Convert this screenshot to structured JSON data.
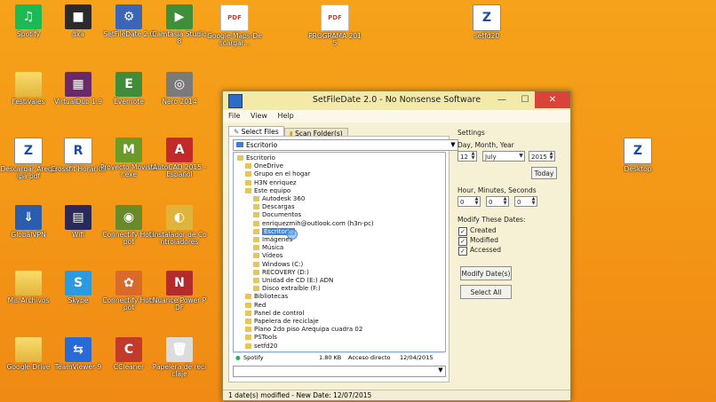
{
  "desktop": {
    "icons": [
      {
        "label": "Spotify",
        "glyph": "♫",
        "color": "#1db954"
      },
      {
        "label": "dxa",
        "glyph": "■",
        "color": "#2b2b2b"
      },
      {
        "label": "SetFileDate 2.0",
        "glyph": "⚙",
        "color": "#3b66b5"
      },
      {
        "label": "Camtasia Studio 8",
        "glyph": "▶",
        "color": "#3e8e3a"
      },
      {
        "label": "Google Maps-Descargar...",
        "glyph": "PDF",
        "color": "#d63c2c"
      },
      {
        "label": "PROGRAMA 2015",
        "glyph": "PDF",
        "color": "#d63c2c"
      },
      {
        "label": "setfd20",
        "glyph": "Z",
        "color": "#ffffff"
      },
      {
        "label": "Festivales",
        "glyph": "▮",
        "color": "#e6b23b"
      },
      {
        "label": "VirtualDub 1.9",
        "glyph": "▦",
        "color": "#6a2a6a"
      },
      {
        "label": "Evernote",
        "glyph": "E",
        "color": "#3f8c3a"
      },
      {
        "label": "Nero 2014",
        "glyph": "◎",
        "color": "#7a7a7a"
      },
      {
        "label": "Descargar Arequipa pdf",
        "glyph": "Z",
        "color": "#ffffff"
      },
      {
        "label": "Crossfit Horarios",
        "glyph": "R",
        "color": "#ffffff"
      },
      {
        "label": "Proyecto Movistar.exe",
        "glyph": "M",
        "color": "#6a9a2a"
      },
      {
        "label": "AutoCAD 2015 - Español",
        "glyph": "A",
        "color": "#c22a2a"
      },
      {
        "label": "Desktop",
        "glyph": "Z",
        "color": "#ffffff"
      },
      {
        "label": "GlobalVPN",
        "glyph": "⇓",
        "color": "#2a5db0"
      },
      {
        "label": "Wifi",
        "glyph": "▤",
        "color": "#2a2a5a"
      },
      {
        "label": "Connectify Hotspot",
        "glyph": "◉",
        "color": "#6a8a2a"
      },
      {
        "label": "Instalador de Controladores",
        "glyph": "◐",
        "color": "#e0b43a"
      },
      {
        "label": "Mis Archivos",
        "glyph": "▮",
        "color": "#e6b23b"
      },
      {
        "label": "Skype",
        "glyph": "S",
        "color": "#2a9be0"
      },
      {
        "label": "Connectify Hotspot",
        "glyph": "✿",
        "color": "#d96a2a"
      },
      {
        "label": "Nuance Power PDF",
        "glyph": "N",
        "color": "#b52a2a"
      },
      {
        "label": "Google Drive",
        "glyph": "▮",
        "color": "#e6b23b"
      },
      {
        "label": "TeamViewer 9",
        "glyph": "⇆",
        "color": "#2a6ad6"
      },
      {
        "label": "CCleaner",
        "glyph": "C",
        "color": "#c23a2a"
      },
      {
        "label": "Papelera de reciclaje",
        "glyph": "🗑",
        "color": "#dcdcdc"
      }
    ]
  },
  "window": {
    "title": "SetFileDate 2.0 - No Nonsense Software",
    "menu": [
      "File",
      "View",
      "Help"
    ],
    "controls": {
      "minimize": "—",
      "maximize": "☐",
      "close": "✕"
    },
    "tabs": [
      "Select Files",
      "Scan Folder(s)"
    ],
    "combo_value": "Escritorio",
    "tree": [
      {
        "label": "Escritorio",
        "indent": 0
      },
      {
        "label": "OneDrive",
        "indent": 1
      },
      {
        "label": "Grupo en el hogar",
        "indent": 1
      },
      {
        "label": "H3N enriquez",
        "indent": 1
      },
      {
        "label": "Este equipo",
        "indent": 1
      },
      {
        "label": "Autodesk 360",
        "indent": 2
      },
      {
        "label": "Descargas",
        "indent": 2
      },
      {
        "label": "Documentos",
        "indent": 2
      },
      {
        "label": "enriquezmih@outlook.com (h3n-pc)",
        "indent": 2
      },
      {
        "label": "Escritorio",
        "indent": 2,
        "selected": true
      },
      {
        "label": "Imágenes",
        "indent": 2
      },
      {
        "label": "Música",
        "indent": 2
      },
      {
        "label": "Vídeos",
        "indent": 2
      },
      {
        "label": "Windows (C:)",
        "indent": 2
      },
      {
        "label": "RECOVERY (D:)",
        "indent": 2
      },
      {
        "label": "Unidad de CD (E:) ADN",
        "indent": 2
      },
      {
        "label": "Disco extraíble (F:)",
        "indent": 2
      },
      {
        "label": "Bibliotecas",
        "indent": 1
      },
      {
        "label": "Red",
        "indent": 1
      },
      {
        "label": "Panel de control",
        "indent": 1
      },
      {
        "label": "Papelera de reciclaje",
        "indent": 1
      },
      {
        "label": "Plano 2do piso Arequipa cuadra 02",
        "indent": 1
      },
      {
        "label": "PSTools",
        "indent": 1
      },
      {
        "label": "setfd20",
        "indent": 1
      }
    ],
    "file_row": {
      "name": "Spotify",
      "size": "1.80 KB",
      "type": "Acceso directo",
      "date": "12/04/2015"
    },
    "settings": {
      "heading": "Settings",
      "date_label": "Day, Month, Year",
      "day": "12",
      "month": "July",
      "year": "2015",
      "today_button": "Today",
      "time_label": "Hour, Minutes, Seconds",
      "hour": "0",
      "minutes": "0",
      "seconds": "0",
      "modify_label": "Modify These Dates:",
      "created": "Created",
      "modified": "Modified",
      "accessed": "Accessed",
      "modify_button": "Modify Date(s)",
      "select_all_button": "Select All"
    },
    "status": "1 date(s) modified - New Date: 12/07/2015"
  }
}
